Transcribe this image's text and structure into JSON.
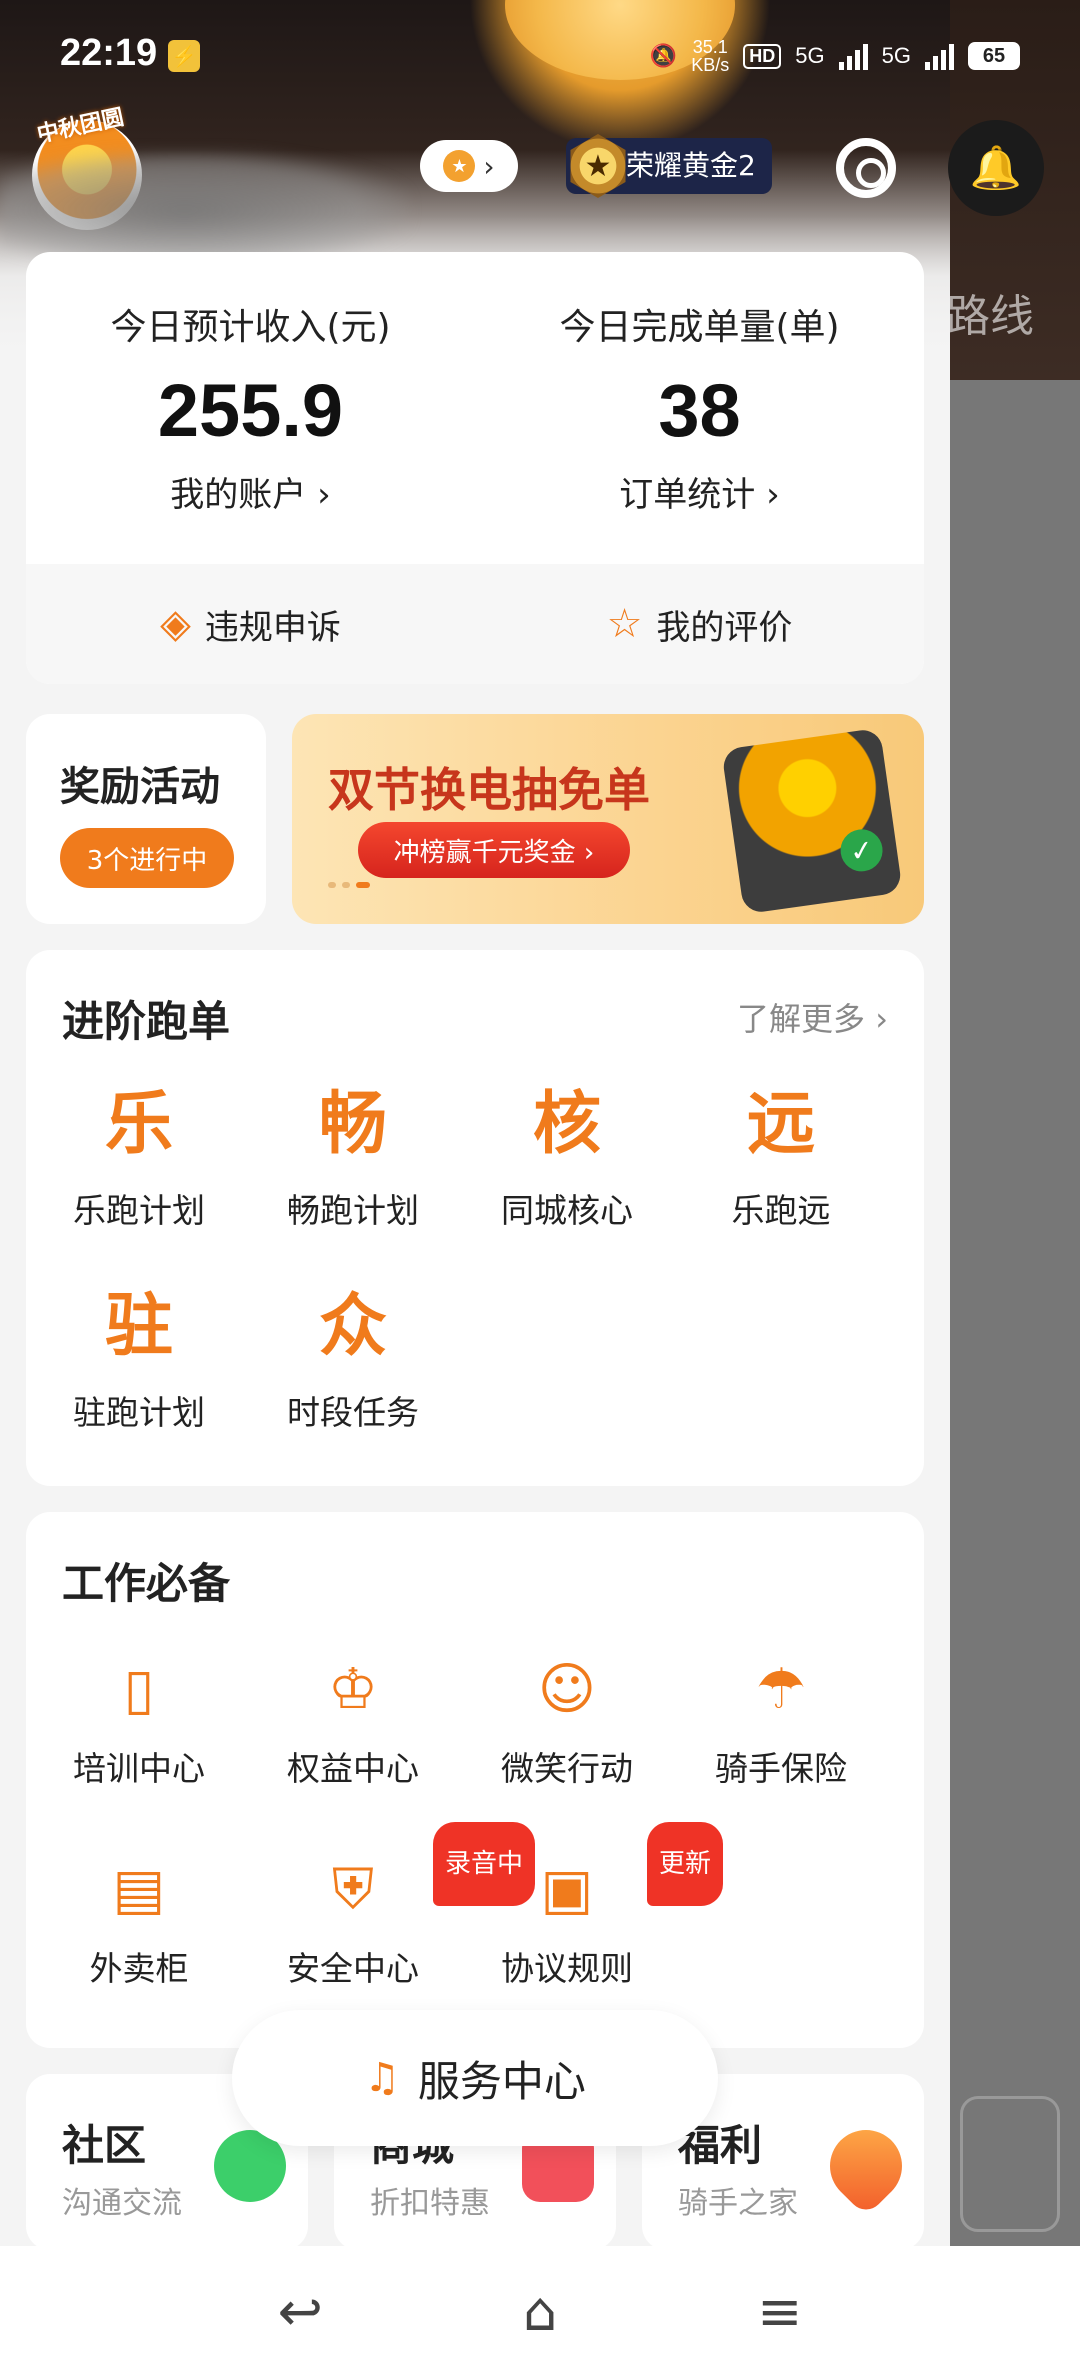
{
  "status_bar": {
    "time": "22:19",
    "net_speed_value": "35.1",
    "net_speed_unit": "KB/s",
    "hd_label": "HD",
    "sim1": "5G",
    "sim2": "5G",
    "battery": "65"
  },
  "background": {
    "route_text": "路线"
  },
  "profile": {
    "avatar_tag": "中秋团圆",
    "level_label": "荣耀黄金2"
  },
  "earnings": {
    "income_label": "今日预计收入(元)",
    "income_value": "255.9",
    "account_link": "我的账户 ›",
    "orders_label": "今日完成单量(单)",
    "orders_value": "38",
    "orders_link": "订单统计 ›",
    "appeal_label": "违规申诉",
    "rating_label": "我的评价"
  },
  "rewards": {
    "title": "奖励活动",
    "badge": "3个进行中",
    "banner_title": "双节换电抽免单",
    "banner_button": "冲榜赢千元奖金 ›"
  },
  "advanced": {
    "title": "进阶跑单",
    "more": "了解更多 ›",
    "items": [
      {
        "glyph": "乐",
        "label": "乐跑计划"
      },
      {
        "glyph": "畅",
        "label": "畅跑计划"
      },
      {
        "glyph": "核",
        "label": "同城核心"
      },
      {
        "glyph": "远",
        "label": "乐跑远"
      },
      {
        "glyph": "驻",
        "label": "驻跑计划"
      },
      {
        "glyph": "众",
        "label": "时段任务"
      }
    ]
  },
  "tools": {
    "title": "工作必备",
    "items": [
      {
        "icon": "book-icon",
        "label": "培训中心"
      },
      {
        "icon": "crown-icon",
        "label": "权益中心"
      },
      {
        "icon": "smile-icon",
        "label": "微笑行动"
      },
      {
        "icon": "umbrella-icon",
        "label": "骑手保险"
      },
      {
        "icon": "locker-icon",
        "label": "外卖柜"
      },
      {
        "icon": "shield-plus-icon",
        "label": "安全中心",
        "tag": "录音中"
      },
      {
        "icon": "document-check-icon",
        "label": "协议规则",
        "tag": "更新"
      }
    ]
  },
  "service_center": {
    "label": "服务中心"
  },
  "bottom_cards": [
    {
      "title": "社区",
      "subtitle": "沟通交流",
      "icon": "chat-bubbles-icon"
    },
    {
      "title": "商城",
      "subtitle": "折扣特惠",
      "icon": "gift-box-icon"
    },
    {
      "title": "福利",
      "subtitle": "骑手之家",
      "icon": "hearts-icon"
    }
  ],
  "colors": {
    "accent": "#f07b1c",
    "tag_red": "#ef3326",
    "level_bg": "#1d2548"
  }
}
